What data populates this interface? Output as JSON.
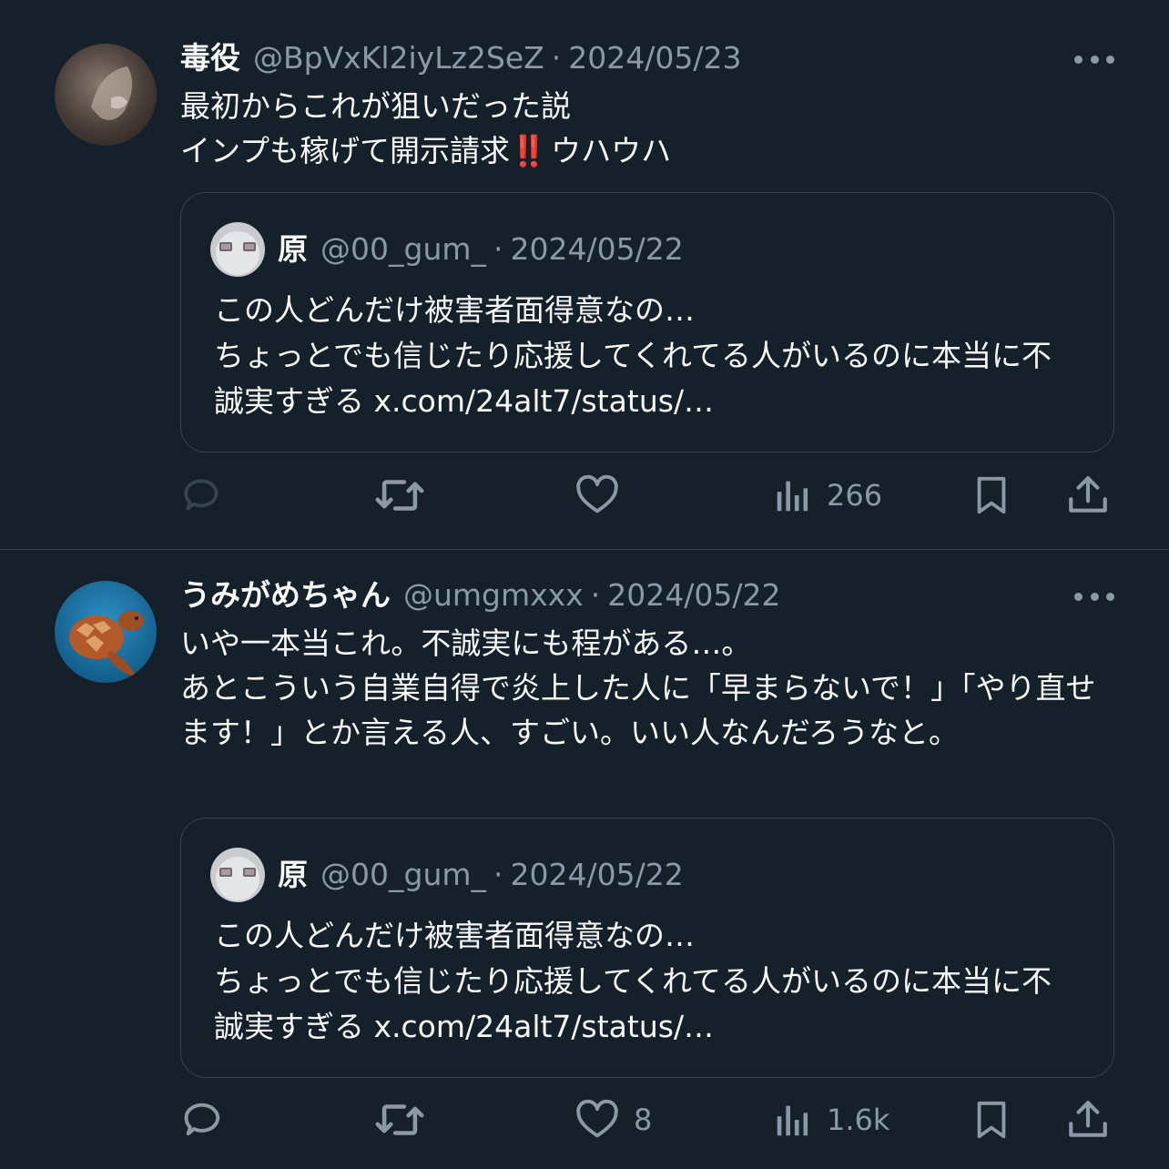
{
  "tweets": [
    {
      "name": "毒役",
      "handle": "@BpVxKl2iyLz2SeZ",
      "date": "2024/05/23",
      "lines": [
        "最初からこれが狙いだった説",
        "インプも稼げて開示請求",
        "ウハウハ"
      ],
      "emoji": "‼️",
      "quote": {
        "name": "原",
        "handle": "@00_gum_",
        "date": "2024/05/22",
        "text": "この人どんだけ被害者面得意なの…\nちょっとでも信じたり応援してくれてる人がいるのに本当に不誠実すぎる x.com/24alt7/status/…"
      },
      "actions": {
        "reply": "",
        "retweet": "",
        "like": "",
        "views": "266"
      }
    },
    {
      "name": "うみがめちゃん",
      "handle": "@umgmxxx",
      "date": "2024/05/22",
      "text": "いや一本当これ。不誠実にも程がある…。\nあとこういう自業自得で炎上した人に「早まらないで！」「やり直せます！」とか言える人、すごい。いい人なんだろうなと。",
      "quote": {
        "name": "原",
        "handle": "@00_gum_",
        "date": "2024/05/22",
        "text": "この人どんだけ被害者面得意なの…\nちょっとでも信じたり応援してくれてる人がいるのに本当に不誠実すぎる x.com/24alt7/status/…"
      },
      "actions": {
        "reply": "",
        "retweet": "",
        "like": "8",
        "views": "1.6k"
      }
    }
  ],
  "separator": "·",
  "icons": [
    "more-icon",
    "reply-icon",
    "retweet-icon",
    "like-icon",
    "views-icon",
    "bookmark-icon",
    "share-icon"
  ],
  "colors": {
    "background": "#15202b",
    "text": "#f7f9f9",
    "muted": "#8b98a5",
    "border": "#38444d"
  }
}
